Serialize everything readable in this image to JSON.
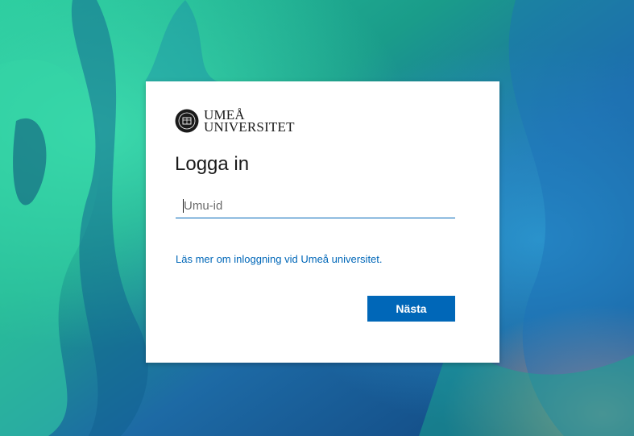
{
  "background": {
    "colors": [
      "#1b9b86",
      "#2fd0a0",
      "#1f5fa8",
      "#0d3f7a",
      "#3a8fb7",
      "#f0a080"
    ]
  },
  "brand": {
    "name_line1": "UMEÅ",
    "name_line2": "UNIVERSITET",
    "logo_icon": "university-seal-icon"
  },
  "login": {
    "title": "Logga in",
    "username_placeholder": "Umu-id",
    "username_value": "",
    "info_link": "Läs mer om inloggning vid Umeå universitet.",
    "next_label": "Nästa"
  },
  "colors": {
    "accent": "#0067b8",
    "card": "#ffffff",
    "text": "#1b1b1b"
  }
}
